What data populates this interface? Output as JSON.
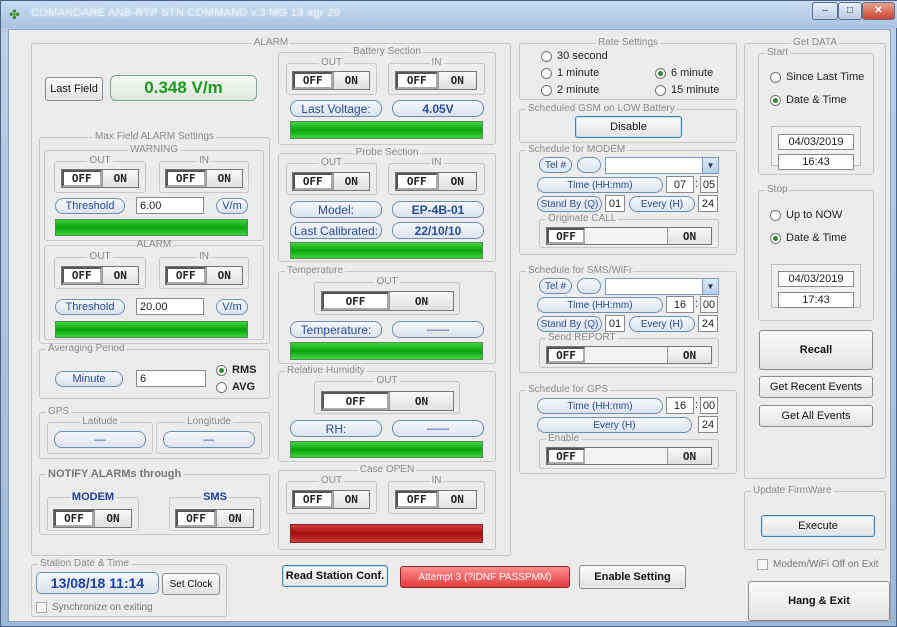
{
  "window": {
    "title": "COMANDARE   ANB-RTP   STN COMMAND   v.3 MG 13 agr 20",
    "icon": "app-icon"
  },
  "alarm": {
    "legend": "ALARM",
    "last_field_btn": "Last Field",
    "field_value": "0.348 V/m",
    "max_field": {
      "legend": "Max Field ALARM Settings",
      "warning": {
        "legend": "WARNING",
        "out": "OUT",
        "in": "IN",
        "off": "OFF",
        "on": "ON",
        "threshold_btn": "Threshold",
        "threshold_value": "6.00",
        "unit": "V/m"
      },
      "alarm": {
        "legend": "ALARM",
        "out": "OUT",
        "in": "IN",
        "off": "OFF",
        "on": "ON",
        "threshold_btn": "Threshold",
        "threshold_value": "20.00",
        "unit": "V/m"
      }
    },
    "averaging": {
      "legend": "Averaging Period",
      "unit_btn": "Minute",
      "value": "6",
      "rms": "RMS",
      "avg": "AVG"
    },
    "gps": {
      "legend": "GPS",
      "latitude": "Latitude",
      "longitude": "Longitude",
      "lat_value": "—",
      "lon_value": "—"
    },
    "notify": {
      "legend": "NOTIFY ALARMs through",
      "modem": "MODEM",
      "sms": "SMS",
      "off": "OFF",
      "on": "ON"
    },
    "battery": {
      "legend": "Battery Section",
      "out": "OUT",
      "in": "IN",
      "off": "OFF",
      "on": "ON",
      "last_voltage": "Last Voltage:",
      "voltage": "4.05V"
    },
    "probe": {
      "legend": "Probe Section",
      "out": "OUT",
      "in": "IN",
      "off": "OFF",
      "on": "ON",
      "model_lbl": "Model:",
      "model": "EP-4B-01",
      "calib_lbl": "Last Calibrated:",
      "calib": "22/10/10"
    },
    "temperature": {
      "legend": "Temperature",
      "out": "OUT",
      "off": "OFF",
      "on": "ON",
      "lbl": "Temperature:",
      "value": "——"
    },
    "humidity": {
      "legend": "Relative Humidity",
      "out": "OUT",
      "off": "OFF",
      "on": "ON",
      "lbl": "RH:",
      "value": "——"
    },
    "case_open": {
      "legend": "Case OPEN",
      "out": "OUT",
      "in": "IN",
      "off": "OFF",
      "on": "ON"
    }
  },
  "station": {
    "legend": "Station Date & Time",
    "datetime": "13/08/18  11:14",
    "set_clock": "Set Clock",
    "sync": "Synchronize on exiting"
  },
  "rate": {
    "legend": "Rate Settings",
    "r30s": "30 second",
    "r1m": "1 minute",
    "r2m": "2 minute",
    "r6m": "6 minute",
    "r15m": "15 minute"
  },
  "gsm": {
    "legend": "Scheduled GSM on LOW Battery",
    "disable": "Disable"
  },
  "modem": {
    "legend": "Schedule for MODEM",
    "tel": "Tel #",
    "time": "Time (HH:mm)",
    "hh": "07",
    "mm": "05",
    "standby": "Stand By (Q)",
    "standby_val": "01",
    "every": "Every (H)",
    "every_val": "24",
    "originate": "Originate CALL",
    "off": "OFF",
    "on": "ON"
  },
  "sms": {
    "legend": "Schedule for SMS/WiFi",
    "tel": "Tel #",
    "time": "Time (HH:mm)",
    "hh": "16",
    "mm": "00",
    "standby": "Stand By (Q)",
    "standby_val": "01",
    "every": "Every (H)",
    "every_val": "24",
    "send": "Send REPORT",
    "off": "OFF",
    "on": "ON"
  },
  "gps_sched": {
    "legend": "Schedule for GPS",
    "time": "Time (HH:mm)",
    "hh": "16",
    "mm": "00",
    "every": "Every (H)",
    "every_val": "24",
    "enable": "Enable",
    "off": "OFF",
    "on": "ON"
  },
  "bottom": {
    "read": "Read Station Conf.",
    "attempt": "Attempt  3 (?IDNF PASSPMM)",
    "enable": "Enable Setting"
  },
  "getdata": {
    "legend": "Get DATA",
    "start": {
      "legend": "Start",
      "since": "Since Last Time",
      "date_time": "Date & Time",
      "date": "04/03/2019",
      "time": "16:43"
    },
    "stop": {
      "legend": "Stop",
      "up_now": "Up to NOW",
      "date_time": "Date & Time",
      "date": "04/03/2019",
      "time": "17:43"
    },
    "recall": "Recall",
    "recent": "Get Recent Events",
    "all": "Get All Events"
  },
  "firmware": {
    "legend": "Update FirmWare",
    "execute": "Execute"
  },
  "modem_off": "Modem/WiFi Off on Exit",
  "hang_exit": "Hang & Exit"
}
